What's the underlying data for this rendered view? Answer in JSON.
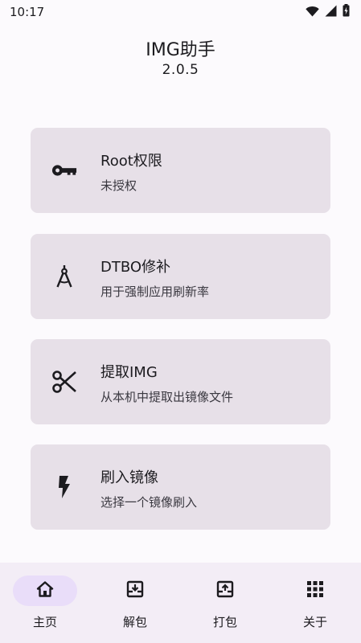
{
  "status_bar": {
    "time": "10:17",
    "icons": [
      "wifi-icon",
      "signal-icon",
      "battery-icon"
    ]
  },
  "header": {
    "title": "IMG助手",
    "version": "2.0.5"
  },
  "cards": [
    {
      "icon": "key-icon",
      "title": "Root权限",
      "subtitle": "未授权"
    },
    {
      "icon": "compass-icon",
      "title": "DTBO修补",
      "subtitle": "用于强制应用刷新率"
    },
    {
      "icon": "scissors-icon",
      "title": "提取IMG",
      "subtitle": "从本机中提取出镜像文件"
    },
    {
      "icon": "flash-icon",
      "title": "刷入镜像",
      "subtitle": "选择一个镜像刷入"
    }
  ],
  "bottom_nav": {
    "items": [
      {
        "icon": "home-icon",
        "label": "主页",
        "active": true
      },
      {
        "icon": "archive-unpack-icon",
        "label": "解包",
        "active": false
      },
      {
        "icon": "archive-pack-icon",
        "label": "打包",
        "active": false
      },
      {
        "icon": "apps-grid-icon",
        "label": "关于",
        "active": false
      }
    ]
  },
  "colors": {
    "background": "#fcfafd",
    "card": "#e7e0e8",
    "nav_background": "#f3edf6",
    "nav_active_pill": "#e9ddf9",
    "text": "#1c1b1f"
  }
}
